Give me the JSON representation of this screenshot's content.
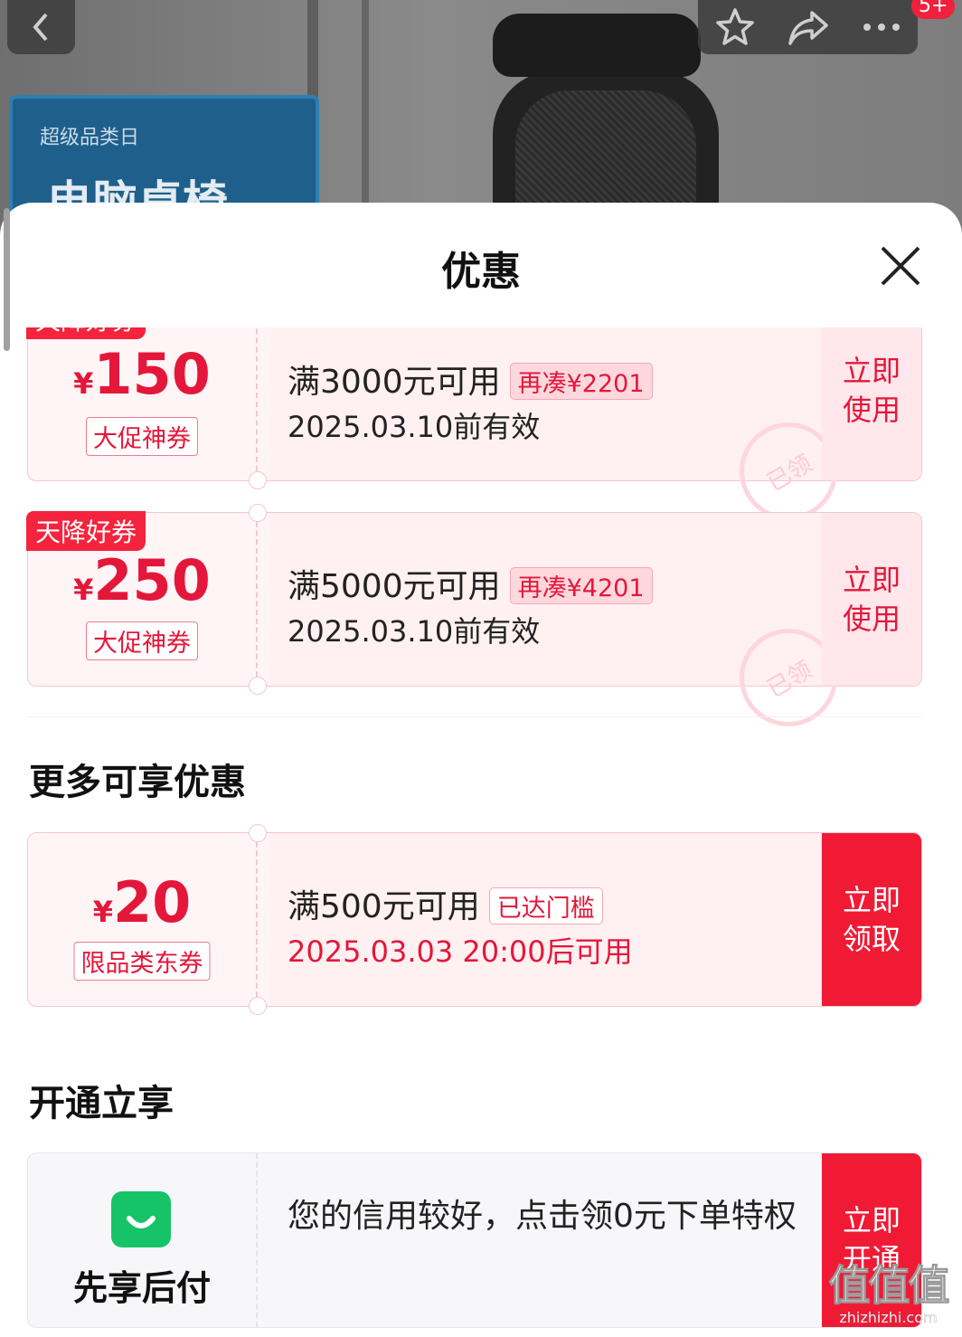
{
  "background": {
    "promo_small": "超级品类日",
    "promo_big": "电脑桌椅",
    "badge": "5+"
  },
  "icons": {
    "back": "chevron-left-icon",
    "favorite": "star-icon",
    "share": "share-arrow-icon",
    "more": "more-dots-icon",
    "close": "close-icon",
    "pay_later": "shopping-bag-icon"
  },
  "sheet": {
    "title": "优惠"
  },
  "coupons": [
    {
      "tag": "天降好券",
      "currency": "¥",
      "amount": "150",
      "label": "大促神券",
      "condition": "满3000元可用",
      "pill": "再凑¥2201",
      "validity": "2025.03.10前有效",
      "stamp": "已领",
      "action_line1": "立即",
      "action_line2": "使用"
    },
    {
      "tag": "天降好券",
      "currency": "¥",
      "amount": "250",
      "label": "大促神券",
      "condition": "满5000元可用",
      "pill": "再凑¥4201",
      "validity": "2025.03.10前有效",
      "stamp": "已领",
      "action_line1": "立即",
      "action_line2": "使用"
    }
  ],
  "more_section": {
    "title": "更多可享优惠",
    "coupon": {
      "currency": "¥",
      "amount": "20",
      "label": "限品类东券",
      "condition": "满500元可用",
      "pill": "已达门槛",
      "validity": "2025.03.03 20:00后可用",
      "action_line1": "立即",
      "action_line2": "领取"
    }
  },
  "open_section": {
    "title": "开通立享",
    "card": {
      "label": "先享后付",
      "text": "您的信用较好，点击领0元下单特权",
      "action_line1": "立即",
      "action_line2": "开通"
    }
  },
  "watermark": {
    "big": "值值值",
    "small": "zhizhizhi.com"
  },
  "colors": {
    "accent": "#f01a35",
    "coupon_bg": "#fff5f6",
    "pay_green": "#16c467"
  }
}
